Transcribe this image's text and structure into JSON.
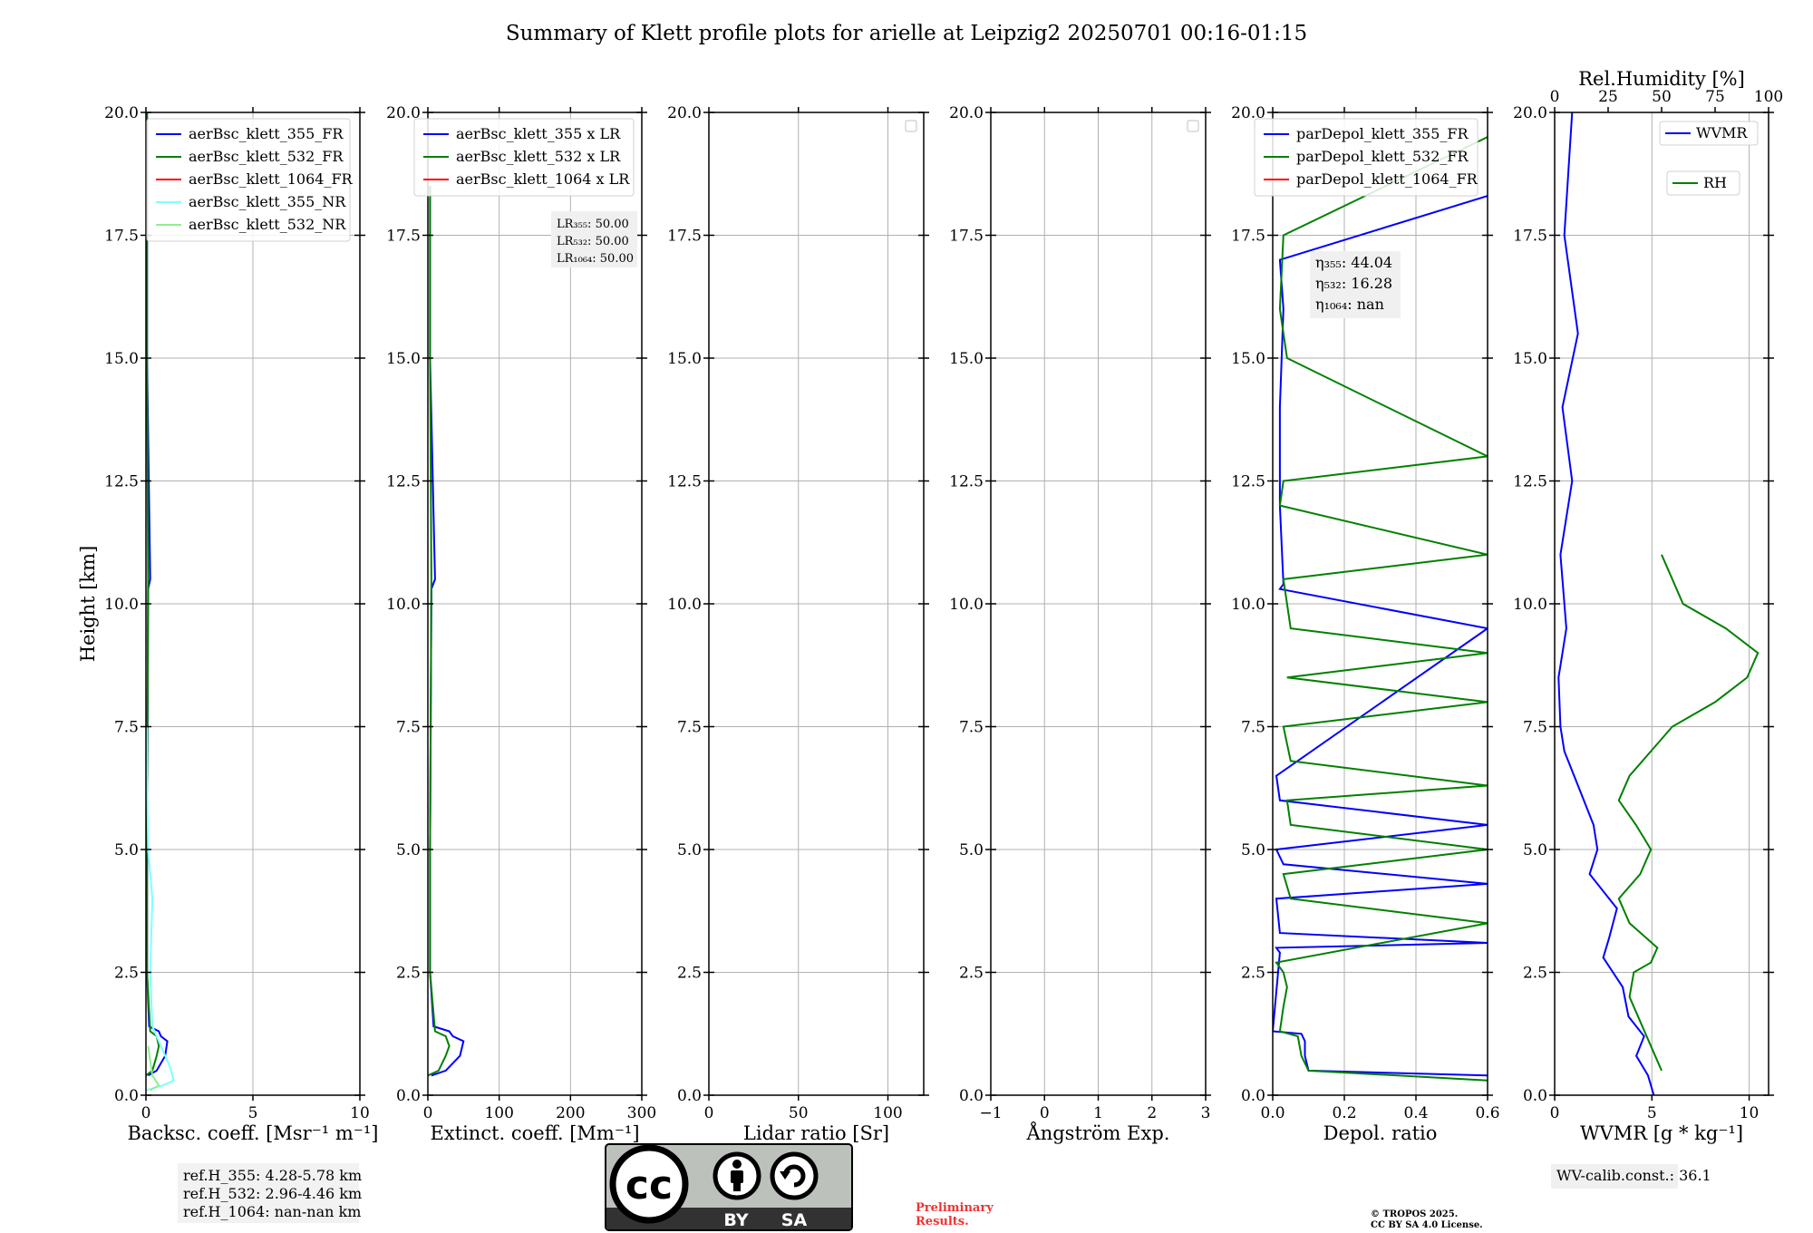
{
  "title": "Summary of Klett profile plots for arielle at Leipzig2 20250701 00:16-01:15",
  "colors": {
    "c355": "#0000ff",
    "c532": "#008000",
    "c1064": "#ff0000",
    "c355nr": "#80ffff",
    "c532nr": "#90ee90"
  },
  "chart_data": [
    {
      "type": "line",
      "id": "bsc",
      "xlabel": "Backsc. coeff. [Msr⁻¹ m⁻¹]",
      "ylabel": "Height [km]",
      "xlim": [
        0,
        10
      ],
      "ylim": [
        0,
        20
      ],
      "xticks": [
        0,
        5,
        10
      ],
      "xtick_labels": [
        "0",
        "5",
        "10"
      ],
      "yticks": [
        0,
        2.5,
        5,
        7.5,
        10,
        12.5,
        15,
        17.5,
        20
      ],
      "ytick_labels": [
        "0.0",
        "2.5",
        "5.0",
        "7.5",
        "10.0",
        "12.5",
        "15.0",
        "17.5",
        "20.0"
      ],
      "grid": true,
      "legend": "top-left",
      "series": [
        {
          "name": "aerBsc_klett_355_FR",
          "color": "#0000ff",
          "x": [
            0.1,
            0.5,
            0.9,
            1.0,
            0.7,
            0.6,
            0.15,
            0.05,
            0.05,
            0.1,
            0.2,
            0.05,
            0.05
          ],
          "y": [
            0.4,
            0.5,
            0.8,
            1.1,
            1.2,
            1.3,
            1.4,
            2.5,
            5,
            10.3,
            10.5,
            15,
            20
          ]
        },
        {
          "name": "aerBsc_klett_532_FR",
          "color": "#008000",
          "x": [
            0,
            0.3,
            0.5,
            0.6,
            0.5,
            0.2,
            0.05,
            0.05,
            0.1,
            0.05,
            0.05
          ],
          "y": [
            0.4,
            0.5,
            0.8,
            1.0,
            1.2,
            1.3,
            2.5,
            5,
            10.5,
            15,
            20
          ]
        },
        {
          "name": "aerBsc_klett_1064_FR",
          "color": "#ff0000",
          "x": [],
          "y": []
        },
        {
          "name": "aerBsc_klett_355_NR",
          "color": "#80ffff",
          "x": [
            0,
            0.8,
            1.3,
            1.1,
            0.7,
            0.3,
            0.2,
            0.3,
            0.1,
            0.05,
            0.05
          ],
          "y": [
            0.1,
            0.2,
            0.3,
            0.6,
            1.0,
            1.4,
            2.5,
            4.0,
            5.0,
            6.5,
            7.5
          ]
        },
        {
          "name": "aerBsc_klett_532_NR",
          "color": "#90ee90",
          "x": [
            0.2,
            0.6,
            0.3,
            0.1
          ],
          "y": [
            0.1,
            0.2,
            0.4,
            1.0
          ]
        }
      ]
    },
    {
      "type": "line",
      "id": "ext",
      "xlabel": "Extinct. coeff. [Mm⁻¹]",
      "xlim": [
        0,
        300
      ],
      "ylim": [
        0,
        20
      ],
      "xticks": [
        0,
        100,
        200,
        300
      ],
      "xtick_labels": [
        "0",
        "100",
        "200",
        "300"
      ],
      "yticks": [
        0,
        2.5,
        5,
        7.5,
        10,
        12.5,
        15,
        17.5,
        20
      ],
      "ytick_labels": [
        "0.0",
        "2.5",
        "5.0",
        "7.5",
        "10.0",
        "12.5",
        "15.0",
        "17.5",
        "20.0"
      ],
      "grid": true,
      "legend": "top-left",
      "series": [
        {
          "name": "aerBsc_klett_355 x LR",
          "color": "#0000ff",
          "x": [
            5,
            25,
            45,
            50,
            35,
            30,
            8,
            3,
            3,
            5,
            10,
            3,
            3
          ],
          "y": [
            0.4,
            0.5,
            0.8,
            1.1,
            1.2,
            1.3,
            1.4,
            2.5,
            5,
            10.3,
            10.5,
            15,
            18.5
          ]
        },
        {
          "name": "aerBsc_klett_532 x LR",
          "color": "#008000",
          "x": [
            0,
            15,
            25,
            30,
            25,
            10,
            3,
            3,
            5,
            3,
            3
          ],
          "y": [
            0.4,
            0.5,
            0.8,
            1.0,
            1.2,
            1.3,
            2.5,
            5,
            10.5,
            15,
            18.5
          ]
        },
        {
          "name": "aerBsc_klett_1064 x LR",
          "color": "#ff0000",
          "x": [],
          "y": []
        }
      ],
      "annotation": [
        "LR₃₅₅: 50.00",
        "LR₅₃₂: 50.00",
        "LR₁₀₆₄: 50.00"
      ]
    },
    {
      "type": "line",
      "id": "lr",
      "xlabel": "Lidar ratio [Sr]",
      "xlim": [
        0,
        120
      ],
      "ylim": [
        0,
        20
      ],
      "xticks": [
        0,
        50,
        100
      ],
      "xtick_labels": [
        "0",
        "50",
        "100"
      ],
      "yticks": [
        0,
        2.5,
        5,
        7.5,
        10,
        12.5,
        15,
        17.5,
        20
      ],
      "ytick_labels": [
        "0.0",
        "2.5",
        "5.0",
        "7.5",
        "10.0",
        "12.5",
        "15.0",
        "17.5",
        "20.0"
      ],
      "grid": true,
      "legend": "top-right (empty)",
      "series": []
    },
    {
      "type": "line",
      "id": "ang",
      "xlabel": "Ångström Exp.",
      "xlim": [
        -1,
        3
      ],
      "ylim": [
        0,
        20
      ],
      "xticks": [
        -1,
        0,
        1,
        2,
        3
      ],
      "xtick_labels": [
        "−1",
        "0",
        "1",
        "2",
        "3"
      ],
      "yticks": [
        0,
        2.5,
        5,
        7.5,
        10,
        12.5,
        15,
        17.5,
        20
      ],
      "ytick_labels": [
        "0.0",
        "2.5",
        "5.0",
        "7.5",
        "10.0",
        "12.5",
        "15.0",
        "17.5",
        "20.0"
      ],
      "grid": true,
      "legend": "top-right (empty)",
      "series": []
    },
    {
      "type": "line",
      "id": "dep",
      "xlabel": "Depol. ratio",
      "xlim": [
        0,
        0.6
      ],
      "ylim": [
        0,
        20
      ],
      "xticks": [
        0,
        0.2,
        0.4,
        0.6
      ],
      "xtick_labels": [
        "0.0",
        "0.2",
        "0.4",
        "0.6"
      ],
      "yticks": [
        0,
        2.5,
        5,
        7.5,
        10,
        12.5,
        15,
        17.5,
        20
      ],
      "ytick_labels": [
        "0.0",
        "2.5",
        "5.0",
        "7.5",
        "10.0",
        "12.5",
        "15.0",
        "17.5",
        "20.0"
      ],
      "grid": true,
      "legend": "top-left",
      "series": [
        {
          "name": "parDepol_klett_355_FR",
          "color": "#0000ff",
          "x": [
            0.6,
            0.1,
            0.09,
            0.09,
            0.08,
            0,
            0.02,
            0.01,
            0.6,
            0.02,
            0.01,
            0.6,
            0.03,
            0.01,
            0.6,
            0.02,
            0.01,
            0.6,
            0.02,
            0.03,
            0.02,
            0.02,
            0.03,
            0.02,
            0.6
          ],
          "y": [
            0.4,
            0.5,
            0.8,
            1.1,
            1.25,
            1.3,
            2.9,
            3.0,
            3.1,
            3.3,
            4.0,
            4.3,
            4.7,
            5.0,
            5.5,
            6.0,
            6.5,
            9.5,
            10.3,
            10.4,
            12.0,
            14.0,
            16.0,
            17.0,
            18.3
          ]
        },
        {
          "name": "parDepol_klett_532_FR",
          "color": "#008000",
          "x": [
            0.6,
            0.1,
            0.08,
            0.07,
            0.02,
            0.03,
            0.04,
            0.03,
            0.01,
            0.6,
            0.05,
            0.03,
            0.6,
            0.05,
            0.04,
            0.6,
            0.05,
            0.03,
            0.6,
            0.04,
            0.6,
            0.05,
            0.03,
            0.6,
            0.02,
            0.03,
            0.6,
            0.04,
            0.02,
            0.03,
            0.6
          ],
          "y": [
            0.3,
            0.5,
            0.8,
            1.2,
            1.3,
            1.8,
            2.2,
            2.5,
            2.7,
            3.5,
            4.0,
            4.5,
            5.0,
            5.5,
            6.0,
            6.3,
            6.8,
            7.5,
            8.0,
            8.5,
            9.0,
            9.5,
            10.5,
            11.0,
            12.0,
            12.5,
            13.0,
            15.0,
            16.0,
            17.5,
            19.5
          ]
        },
        {
          "name": "parDepol_klett_1064_FR",
          "color": "#ff0000",
          "x": [],
          "y": []
        }
      ],
      "annotation": [
        "η₃₅₅: 44.04",
        "η₅₃₂: 16.28",
        "η₁₀₆₄: nan"
      ]
    },
    {
      "type": "line",
      "id": "wv",
      "xlabel": "WVMR [g * kg⁻¹]",
      "x2label": "Rel.Humidity [%]",
      "xlim": [
        0,
        11
      ],
      "x2lim": [
        0,
        100
      ],
      "ylim": [
        0,
        20
      ],
      "xticks": [
        0,
        5,
        10
      ],
      "xtick_labels": [
        "0",
        "5",
        "10"
      ],
      "x2ticks": [
        0,
        25,
        50,
        75,
        100
      ],
      "x2tick_labels": [
        "0",
        "25",
        "50",
        "75",
        "100"
      ],
      "yticks": [
        0,
        2.5,
        5,
        7.5,
        10,
        12.5,
        15,
        17.5,
        20
      ],
      "ytick_labels": [
        "0.0",
        "2.5",
        "5.0",
        "7.5",
        "10.0",
        "12.5",
        "15.0",
        "17.5",
        "20.0"
      ],
      "grid": true,
      "legend": "top-right",
      "series": [
        {
          "name": "WVMR",
          "color": "#0000ff",
          "x": [
            5.1,
            4.8,
            4.2,
            4.6,
            3.8,
            3.5,
            2.5,
            2.8,
            3.2,
            1.8,
            2.2,
            2.0,
            1.5,
            1.0,
            0.5,
            0.3,
            0.2,
            0.6,
            0.3,
            0.9,
            0.4,
            1.2,
            0.5,
            0.9
          ],
          "y": [
            0,
            0.4,
            0.8,
            1.2,
            1.6,
            2.2,
            2.8,
            3.2,
            3.8,
            4.5,
            5.0,
            5.5,
            6.0,
            6.5,
            7.0,
            7.5,
            8.5,
            9.5,
            11,
            12.5,
            14,
            15.5,
            17.5,
            20
          ]
        },
        {
          "name": "RH",
          "color": "#008000",
          "x": [
            50,
            45,
            40,
            35,
            37,
            45,
            48,
            35,
            30,
            40,
            45,
            38,
            30,
            35,
            45,
            55,
            75,
            90,
            95,
            80,
            60,
            55,
            50
          ],
          "y": [
            0.5,
            1.0,
            1.5,
            2.0,
            2.5,
            2.7,
            3.0,
            3.5,
            4.0,
            4.5,
            5.0,
            5.5,
            6.0,
            6.5,
            7.0,
            7.5,
            8.0,
            8.5,
            9.0,
            9.5,
            10.0,
            10.5,
            11.0
          ]
        }
      ],
      "annotation": [
        "WV-calib.const.: 36.1"
      ]
    }
  ],
  "footer": {
    "ref_h": [
      "ref.H_355: 4.28-5.78 km",
      "ref.H_532: 2.96-4.46 km",
      "ref.H_1064: nan-nan km"
    ],
    "cc_cc": "cc",
    "cc_by": "BY",
    "cc_sa": "SA",
    "preliminary": [
      "Preliminary",
      "Results."
    ],
    "copyright": [
      "© TROPOS 2025.",
      "CC BY SA 4.0 License."
    ]
  }
}
